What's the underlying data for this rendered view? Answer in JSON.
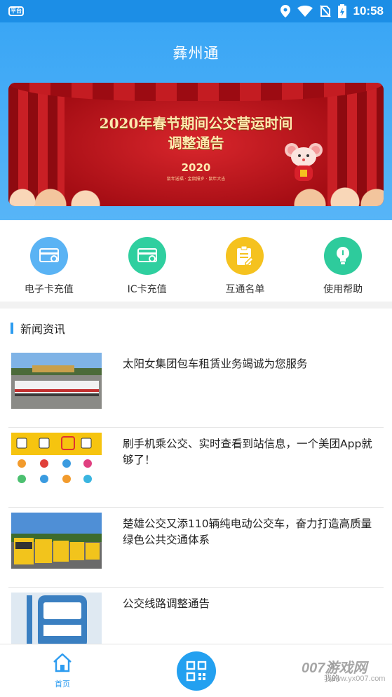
{
  "status_bar": {
    "left_badge": "平台",
    "time": "10:58",
    "icons": [
      "location-icon",
      "wifi-icon",
      "no-sim-icon",
      "battery-icon"
    ]
  },
  "header": {
    "title": "彝州通"
  },
  "banner": {
    "line1": "2020年春节期间公交营运时间",
    "line2": "调整通告",
    "year": "2020",
    "subtext": "鼠年送福 · 金鼠报岁 · 鼠年大吉"
  },
  "shortcuts": [
    {
      "label": "电子卡充值",
      "icon": "ecard-icon",
      "color": "#5ab3f4"
    },
    {
      "label": "IC卡充值",
      "icon": "iccard-icon",
      "color": "#2fcf9f"
    },
    {
      "label": "互通名单",
      "icon": "list-icon",
      "color": "#f5c21f"
    },
    {
      "label": "使用帮助",
      "icon": "help-icon",
      "color": "#2ecb9c"
    }
  ],
  "news": {
    "section_title": "新闻资讯",
    "items": [
      {
        "title": "太阳女集团包车租赁业务竭诚为您服务"
      },
      {
        "title": "刷手机乘公交、实时查看到站信息，一个美团App就够了！"
      },
      {
        "title": "楚雄公交又添110辆纯电动公交车，奋力打造高质量绿色公共交通体系"
      },
      {
        "title": "公交线路调整通告"
      }
    ]
  },
  "tabbar": {
    "home_label": "首页",
    "mine_label": "我的"
  },
  "watermark": {
    "main": "007游戏网",
    "sub": "www.yx007.com"
  },
  "colors": {
    "primary": "#2d9cf0",
    "header_bg": "#3aa6f5"
  }
}
